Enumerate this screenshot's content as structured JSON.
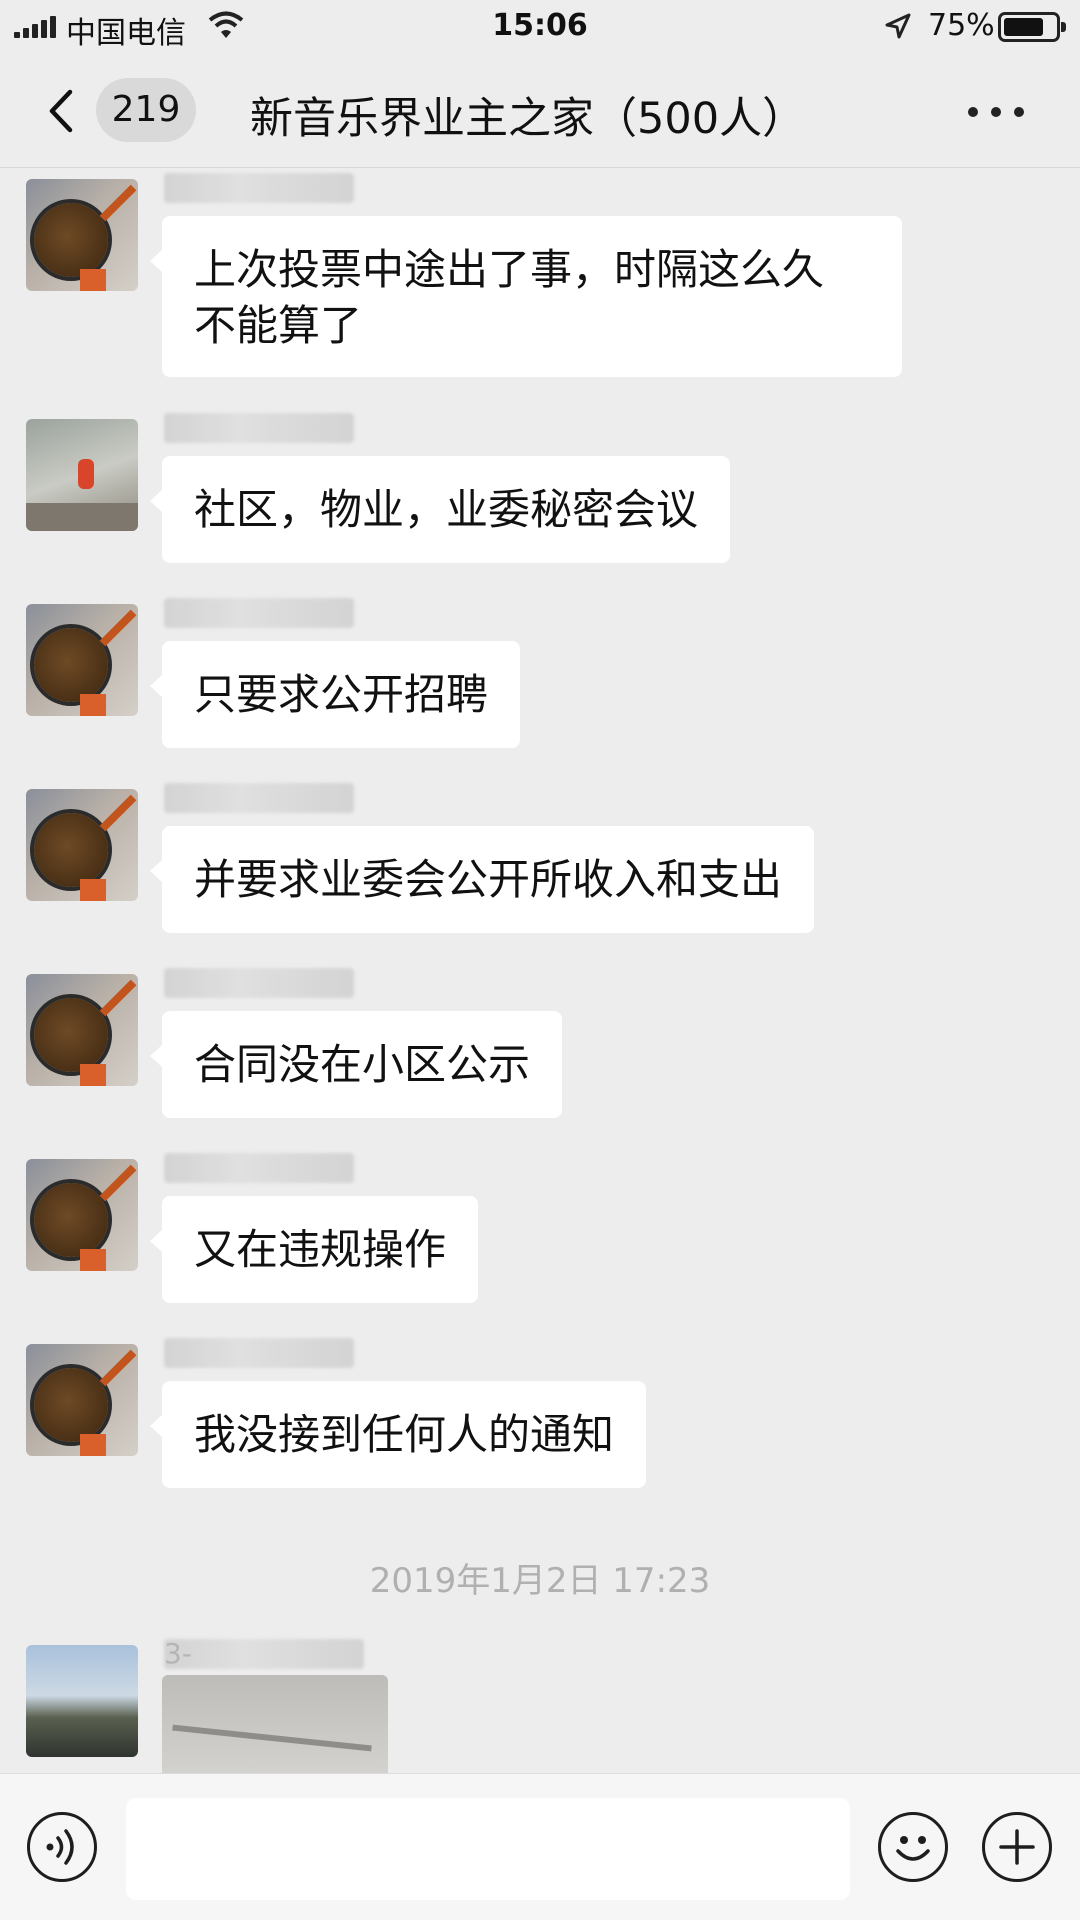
{
  "status_bar": {
    "carrier": "中国电信",
    "time": "15:06",
    "battery_percent": "75%",
    "battery_level": 0.75
  },
  "nav": {
    "unread_count": "219",
    "title": "新音乐界业主之家（500人）"
  },
  "messages": [
    {
      "avatar": "pan-avatar",
      "lines": [
        "上次投票中途出了事，时隔这么久",
        "不能算了"
      ]
    },
    {
      "avatar": "street-avatar",
      "lines": [
        "社区，物业，业委秘密会议"
      ]
    },
    {
      "avatar": "pan-avatar",
      "lines": [
        "只要求公开招聘"
      ]
    },
    {
      "avatar": "pan-avatar",
      "lines": [
        "并要求业委会公开所收入和支出"
      ]
    },
    {
      "avatar": "pan-avatar",
      "lines": [
        "合同没在小区公示"
      ]
    },
    {
      "avatar": "pan-avatar",
      "lines": [
        "又在违规操作"
      ]
    },
    {
      "avatar": "pan-avatar",
      "lines": [
        "我没接到任何人的通知"
      ]
    }
  ],
  "timestamp": "2019年1月2日 17:23",
  "last_message": {
    "sender_prefix": "3-",
    "type": "image",
    "avatar": "landscape-avatar"
  },
  "input": {
    "value": "",
    "placeholder": ""
  },
  "icons": {
    "back": "chevron-left-icon",
    "more": "more-dots-icon",
    "voice": "voice-icon",
    "emoji": "emoji-icon",
    "add": "plus-icon"
  }
}
